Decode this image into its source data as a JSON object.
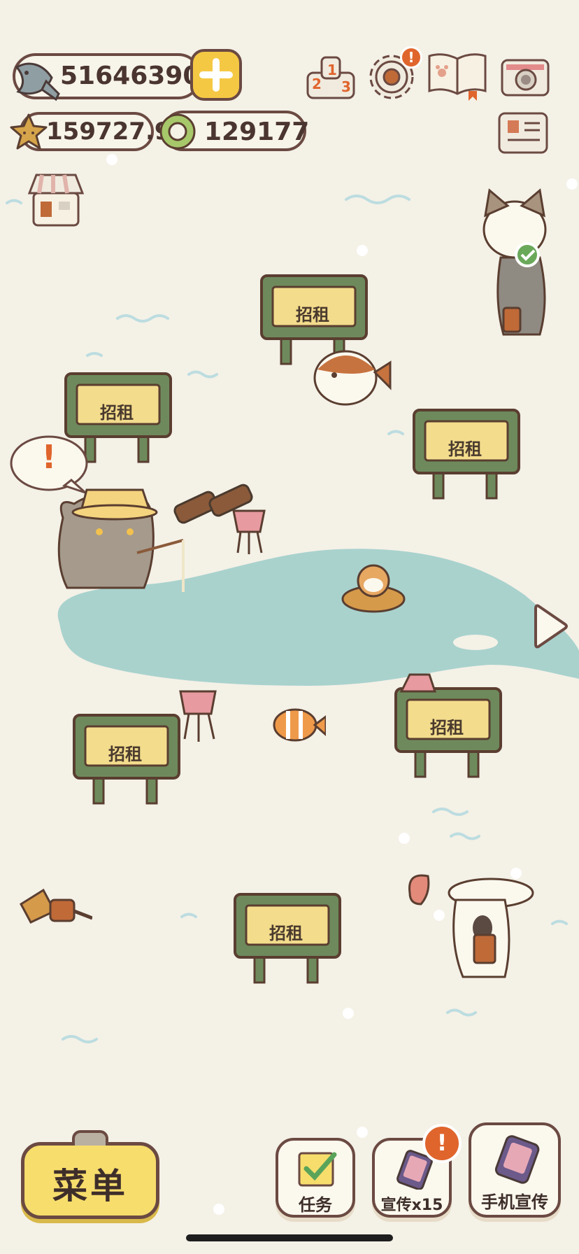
{
  "currency": {
    "fish": "516463903",
    "stars": "159727.9",
    "rings": "129177"
  },
  "signs": {
    "rent": "招租"
  },
  "bottom": {
    "menu": "菜单",
    "tasks": "任务",
    "promote": "宣传x15",
    "phone_promote": "手机宣传"
  },
  "icons": {
    "alert_mark": "!",
    "ranking_digits": [
      "2",
      "1",
      "3"
    ]
  },
  "colors": {
    "background": "#f4f1e7",
    "outline": "#6b4a42",
    "pond": "#a9d2cd",
    "sign_frame": "#6e8a5c",
    "sign_board": "#f3dc8c",
    "alert_orange": "#e0652d",
    "menu_yellow": "#f7dd6c"
  }
}
